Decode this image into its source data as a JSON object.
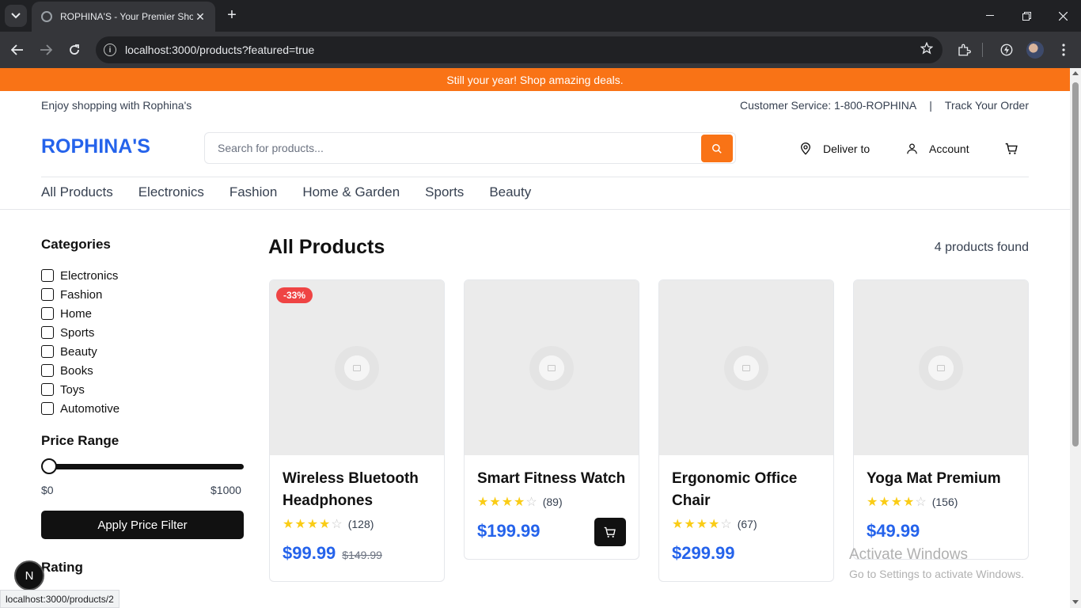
{
  "browser": {
    "tab_title": "ROPHINA'S - Your Premier Shop",
    "url": "localhost:3000/products?featured=true",
    "status_url": "localhost:3000/products/2"
  },
  "promo": {
    "text": "Still your year! Shop amazing deals."
  },
  "topbar": {
    "left": "Enjoy shopping with Rophina's",
    "customer_service": "Customer Service: 1-800-ROPHINA",
    "separator": "|",
    "track_order": "Track Your Order"
  },
  "header": {
    "logo": "ROPHINA'S",
    "search_placeholder": "Search for products...",
    "deliver_to": "Deliver to",
    "account": "Account"
  },
  "category_nav": [
    "All Products",
    "Electronics",
    "Fashion",
    "Home & Garden",
    "Sports",
    "Beauty"
  ],
  "sidebar": {
    "categories_title": "Categories",
    "categories": [
      "Electronics",
      "Fashion",
      "Home",
      "Sports",
      "Beauty",
      "Books",
      "Toys",
      "Automotive"
    ],
    "price_title": "Price Range",
    "price_min_label": "$0",
    "price_max_label": "$1000",
    "price_slider_value": 0,
    "apply_label": "Apply Price Filter",
    "rating_title": "Rating"
  },
  "main": {
    "title": "All Products",
    "count": "4 products found"
  },
  "products": [
    {
      "badge": "-33%",
      "name_line1": "Wireless Bluetooth",
      "name_line2": "Headphones",
      "stars": 4,
      "rating_count": "(128)",
      "price": "$99.99",
      "old_price": "$149.99"
    },
    {
      "badge": "",
      "name_line1": "Smart Fitness Watch",
      "name_line2": "",
      "stars": 4,
      "rating_count": "(89)",
      "price": "$199.99",
      "old_price": ""
    },
    {
      "badge": "",
      "name_line1": "Ergonomic Office",
      "name_line2": "Chair",
      "stars": 4,
      "rating_count": "(67)",
      "price": "$299.99",
      "old_price": ""
    },
    {
      "badge": "",
      "name_line1": "Yoga Mat Premium",
      "name_line2": "",
      "stars": 4,
      "rating_count": "(156)",
      "price": "$49.99",
      "old_price": ""
    }
  ],
  "overlay": {
    "activate_title": "Activate Windows",
    "activate_sub": "Go to Settings to activate Windows.",
    "next_badge": "N"
  },
  "colors": {
    "accent": "#f97316",
    "brand": "#2563eb",
    "sale": "#ef4444",
    "star": "#facc15"
  },
  "icons": [
    "tab-list-icon",
    "close-icon",
    "plus-icon",
    "minimize-icon",
    "restore-icon",
    "back-arrow-icon",
    "forward-arrow-icon",
    "reload-icon",
    "info-icon",
    "star-bookmark-icon",
    "extensions-icon",
    "search-icon",
    "location-pin-icon",
    "user-icon",
    "cart-icon"
  ]
}
